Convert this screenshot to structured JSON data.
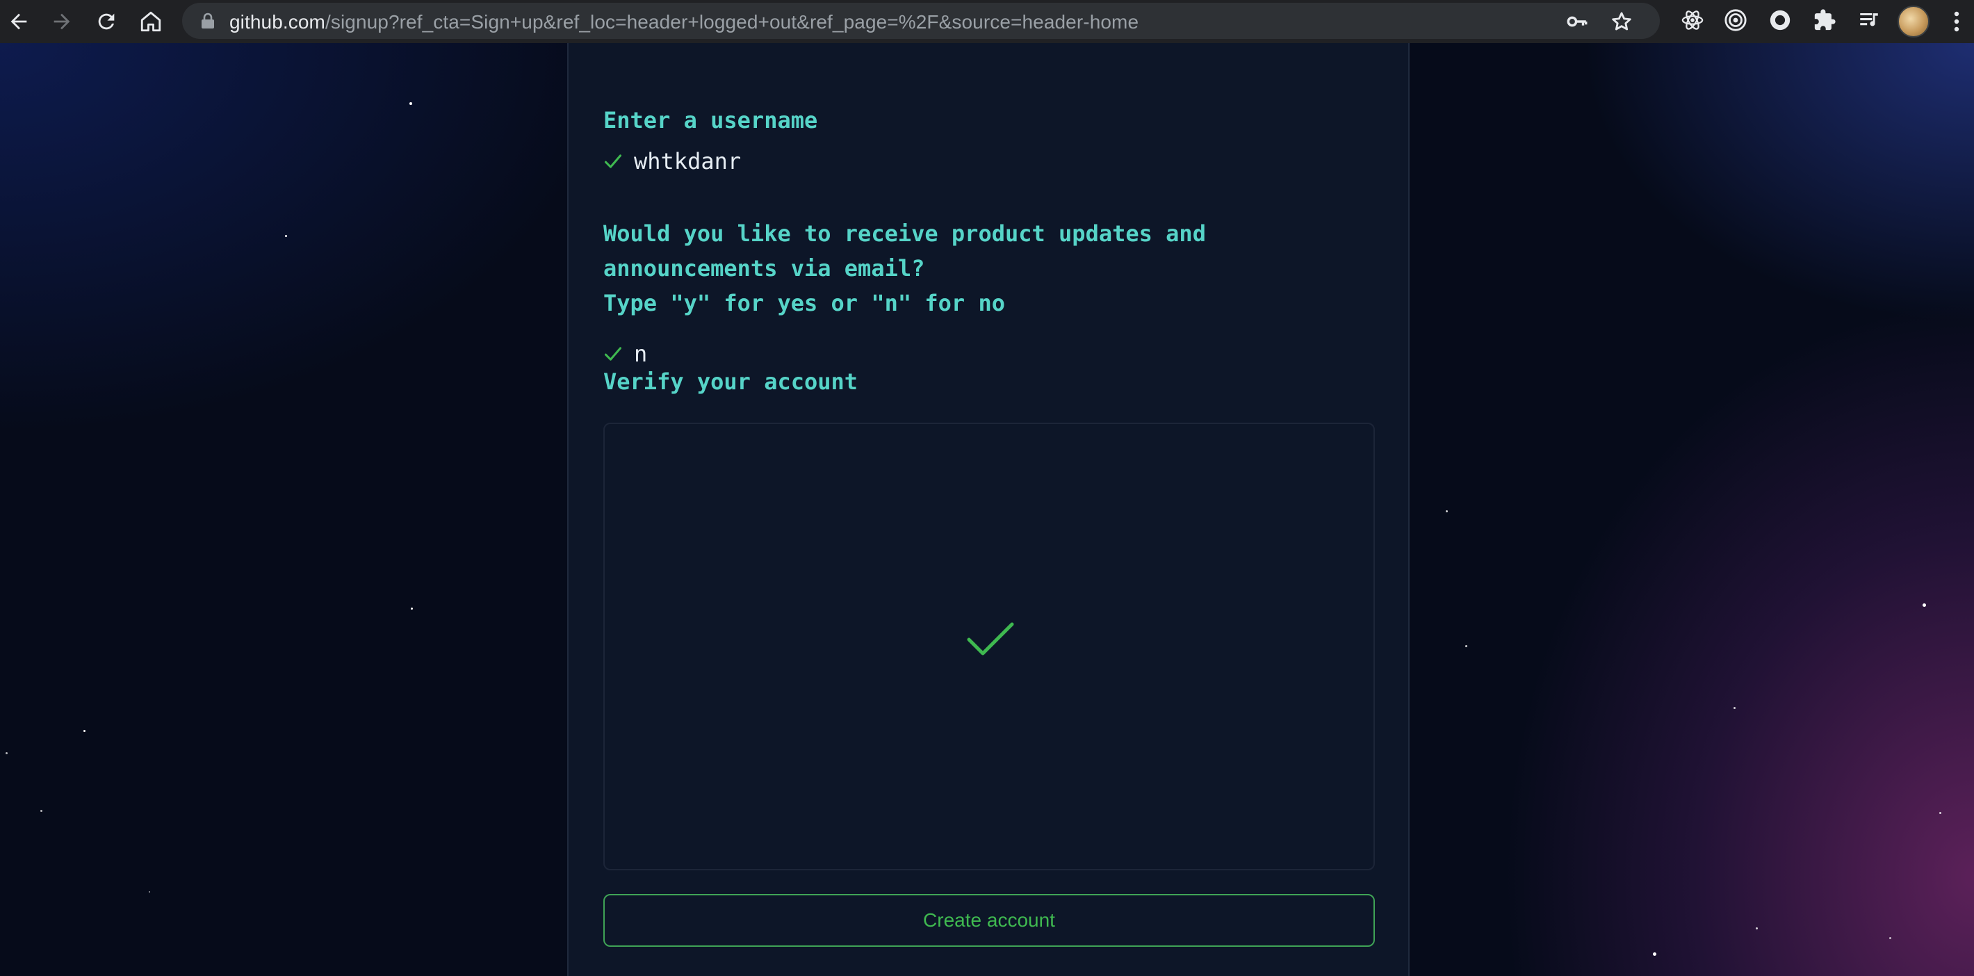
{
  "browser": {
    "url_host": "github.com",
    "url_path": "/signup?ref_cta=Sign+up&ref_loc=header+logged+out&ref_page=%2F&source=header-home",
    "icons": [
      "back-icon",
      "forward-icon",
      "reload-icon",
      "home-icon",
      "lock-icon",
      "key-icon",
      "star-icon",
      "react-devtools-icon",
      "target-extension-icon",
      "circle-extension-icon",
      "puzzle-extensions-icon",
      "media-queue-icon",
      "profile-avatar",
      "menu-dots-icon"
    ]
  },
  "signup": {
    "username_prompt": "Enter a username",
    "username_value": "whtkdanr",
    "email_prompt_line1": "Would you like to receive product updates and",
    "email_prompt_line2": "announcements via email?",
    "email_prompt_line3": "Type \"y\" for yes or \"n\" for no",
    "email_value": "n",
    "verify_prompt": "Verify your account",
    "create_button": "Create account"
  },
  "colors": {
    "prompt": "#56d4c8",
    "check": "#3fb950",
    "panel_bg": "#0d1628",
    "button_border": "#3fa356"
  }
}
